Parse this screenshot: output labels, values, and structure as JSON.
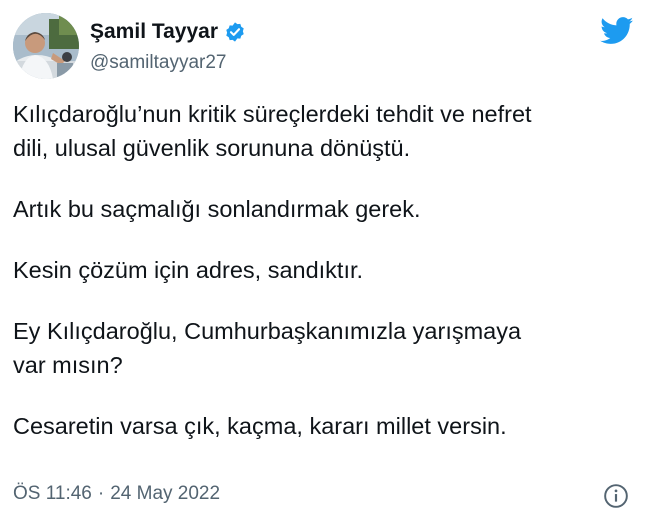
{
  "user": {
    "display_name": "Şamil Tayyar",
    "handle": "@samiltayyar27",
    "verified": true,
    "avatar_icon": "profile-photo"
  },
  "icons": {
    "brand": "twitter-bird-icon",
    "verified": "verified-badge-icon",
    "info": "info-icon"
  },
  "colors": {
    "brand_blue": "#1d9bf0",
    "text": "#0f1419",
    "secondary_text": "#536471"
  },
  "tweet": {
    "paragraphs": [
      "Kılıçdaroğlu’nun kritik süreçlerdeki tehdit ve nefret\ndili, ulusal güvenlik sorununa dönüştü.",
      "Artık bu saçmalığı sonlandırmak gerek.",
      "Kesin çözüm için adres, sandıktır.",
      "Ey Kılıçdaroğlu, Cumhurbaşkanımızla yarışmaya\nvar mısın?",
      "Cesaretin varsa çık, kaçma, kararı millet versin."
    ],
    "time": "ÖS 11:46",
    "separator": "·",
    "date": "24 May 2022"
  }
}
